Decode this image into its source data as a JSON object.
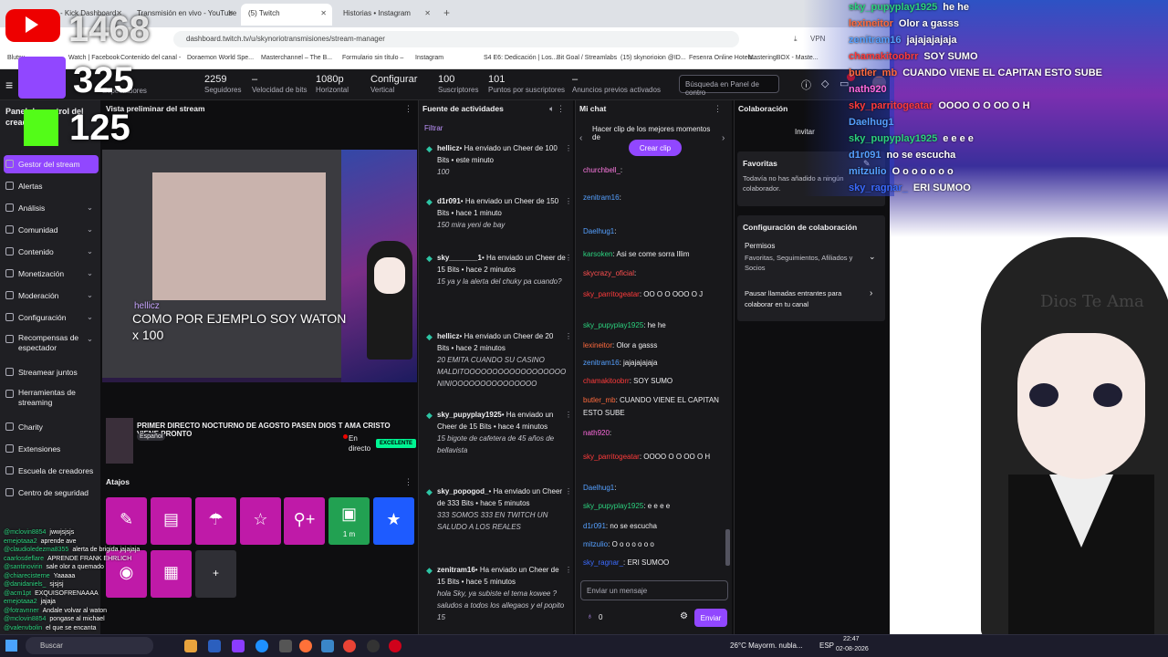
{
  "browser": {
    "tabs": [
      "Stream - Kick Dashboard",
      "Transmisión en vivo - YouTube",
      "(5) Twitch",
      "Historias • Instagram"
    ],
    "url": "dashboard.twitch.tv/u/skynoriotransmisiones/stream-manager",
    "bookmarks": [
      "Blutsu",
      "Watch | Facebook",
      "Contenido del canal -",
      "Doraemon World Spe...",
      "Masterchannel – The B...",
      "Formulario sin título –",
      "Instagram",
      "S4 E6: Dedicación | Los...",
      "Bit Goal / Streamlabs",
      "(15) skynorioion @ID...",
      "Fesenra Online Hotels...",
      "MasteringBOX - Maste..."
    ]
  },
  "topbar": {
    "stats": [
      {
        "value": "2259",
        "label": "Seguidores"
      },
      {
        "value": "–",
        "label": "Velocidad de bits"
      },
      {
        "value": "1080p",
        "label": "Horizontal"
      },
      {
        "value": "Configurar",
        "label": "Vertical"
      },
      {
        "value": "100",
        "label": "Suscriptores"
      },
      {
        "value": "101",
        "label": "Puntos por suscriptores"
      },
      {
        "value": "–",
        "label": "Anuncios previos activados"
      }
    ],
    "viewers_label": "Espectadores",
    "search_placeholder": "Búsqueda en Panel de contro",
    "notif_count": "1"
  },
  "overlay_left": {
    "counter1": "1468",
    "counter2": "325",
    "counter3": "125"
  },
  "nav": {
    "title": "Panel de control del creador",
    "items": [
      {
        "label": "Gestor del stream",
        "active": true
      },
      {
        "label": "Alertas"
      },
      {
        "label": "Análisis",
        "chev": true
      },
      {
        "label": "Comunidad",
        "chev": true
      },
      {
        "label": "Contenido",
        "chev": true
      },
      {
        "label": "Monetización",
        "chev": true
      },
      {
        "label": "Moderación",
        "chev": true
      },
      {
        "label": "Configuración",
        "chev": true
      },
      {
        "label": "Recompensas de espectador",
        "chev": true
      },
      {
        "label": "Streamear juntos"
      },
      {
        "label": "Herramientas de streaming"
      },
      {
        "label": "Charity"
      },
      {
        "label": "Extensiones"
      },
      {
        "label": "Escuela de creadores"
      },
      {
        "label": "Centro de seguridad"
      }
    ]
  },
  "preview": {
    "header": "Vista preliminar del stream",
    "overlay_text": "COMO POR EJEMPLO SOY WATON x 100",
    "user": "hellicz",
    "title": "PRIMER DIRECTO NOCTURNO DE AGOSTO PASEN DIOS T AMA CRISTO VIENE PRONTO",
    "lang": "Español",
    "live": "En directo",
    "quality": "EXCELENTE"
  },
  "actions": {
    "header": "Atajos",
    "timer": "1 m",
    "add": "+"
  },
  "feed": {
    "header": "Fuente de actividades",
    "filter": "Filtrar",
    "items": [
      {
        "user": "hellicz",
        "text": "• Ha enviado un Cheer de 100 Bits • este minuto",
        "msg": "100"
      },
      {
        "user": "d1r091",
        "text": "• Ha enviado un Cheer de 150 Bits • hace 1 minuto",
        "msg": "150 mira yeni de bay"
      },
      {
        "user": "sky_______1",
        "text": "• Ha enviado un Cheer de 15 Bits • hace 2 minutos",
        "msg": "15 ya y la alerta del chuky pa cuando?"
      },
      {
        "user": "hellicz",
        "text": "• Ha enviado un Cheer de 20 Bits • hace 2 minutos",
        "msg": "20 EMITA CUANDO SU CASINO MALDITOOOOOOOOOOOOOOOOOO NINIOOOOOOOOOOOOOOO"
      },
      {
        "user": "sky_pupyplay1925",
        "text": "• Ha enviado un Cheer de 15 Bits • hace 4 minutos",
        "msg": "15 bigote de cafetera de 45 años de bellavista"
      },
      {
        "user": "sky_popogod_",
        "text": "• Ha enviado un Cheer de 333 Bits • hace 5 minutos",
        "msg": "333 SOMOS 333 EN TWITCH UN SALUDO A LOS REALES"
      },
      {
        "user": "zenitram16",
        "text": "• Ha enviado un Cheer de 15 Bits • hace 5 minutos",
        "msg": "hola Sky, ya subiste el tema kowee ? saludos a todos los allegaos y el popito 15"
      }
    ]
  },
  "chat": {
    "header": "Mi chat",
    "clip_banner": "Hacer clip de los mejores momentos de",
    "clip_button": "Crear clip",
    "input_placeholder": "Enviar un mensaje",
    "send": "Enviar",
    "points": "0",
    "lines": [
      {
        "user": "churchbell_",
        "color": "#ff7ae3",
        "msg": ""
      },
      {
        "user": "zenitram16",
        "color": "#55a0ff",
        "msg": ""
      },
      {
        "user": "Daelhug1",
        "color": "#55a0ff",
        "msg": ""
      },
      {
        "user": "karsoken",
        "color": "#2cd37f",
        "msg": "Asi se come sorra lllim"
      },
      {
        "user": "skycrazy_oficial",
        "color": "#ff4f4f",
        "msg": ""
      },
      {
        "user": "sky_parritogeatar",
        "color": "#ff3b3b",
        "msg": "OO O O OOO O J"
      },
      {
        "user": "sky_pupyplay1925",
        "color": "#2cd37f",
        "msg": "he he"
      },
      {
        "user": "lexineitor",
        "color": "#ff6a3d",
        "msg": "Olor a gasss"
      },
      {
        "user": "zenitram16",
        "color": "#55a0ff",
        "msg": "jajajajajaja"
      },
      {
        "user": "chamakitoobrr",
        "color": "#ff3b3b",
        "msg": "SOY SUMO"
      },
      {
        "user": "butler_mb",
        "color": "#ff6a3d",
        "msg": "CUANDO VIENE EL CAPITAN ESTO SUBE"
      },
      {
        "user": "nath920",
        "color": "#ff6adf",
        "msg": ""
      },
      {
        "user": "sky_parritogeatar",
        "color": "#ff3b3b",
        "msg": "OOOO O O OO O H"
      },
      {
        "user": "Daelhug1",
        "color": "#55a0ff",
        "msg": ""
      },
      {
        "user": "sky_pupyplay1925",
        "color": "#2cd37f",
        "msg": "e e e e"
      },
      {
        "user": "d1r091",
        "color": "#55a0ff",
        "msg": "no se escucha"
      },
      {
        "user": "mitzulio",
        "color": "#55a0ff",
        "msg": "O o o o o o o"
      },
      {
        "user": "sky_ragnar_",
        "color": "#3b6bff",
        "msg": "ERI SUMOO"
      }
    ]
  },
  "collab": {
    "header": "Colaboración",
    "invite": "Invitar",
    "fav_title": "Favoritas",
    "fav_text": "Todavía no has añadido a ningún colaborador.",
    "config_title": "Configuración de colaboración",
    "perm_title": "Permisos",
    "perm_text": "Favoritas, Seguimientos, Afiliados y Socios",
    "pause_text": "Pausar llamadas entrantes para colaborar en tu canal"
  },
  "overlay_chat": [
    {
      "user": "sky_pupyplay1925",
      "color": "#2cd37f",
      "msg": "he he"
    },
    {
      "user": "lexineitor",
      "color": "#ff6a3d",
      "msg": "Olor a gasss"
    },
    {
      "user": "zenitram16",
      "color": "#55a0ff",
      "msg": "jajajajajaja"
    },
    {
      "user": "chamakitoobrr",
      "color": "#ff3b3b",
      "msg": "SOY SUMO"
    },
    {
      "user": "butler_mb",
      "color": "#ff6a3d",
      "msg": "CUANDO VIENE EL CAPITAN ESTO SUBE"
    },
    {
      "user": "nath920",
      "color": "#ff6adf",
      "msg": ""
    },
    {
      "user": "sky_parritogeatar",
      "color": "#ff3b3b",
      "msg": "OOOO O O OO O H"
    },
    {
      "user": "Daelhug1",
      "color": "#55a0ff",
      "msg": ""
    },
    {
      "user": "sky_pupyplay1925",
      "color": "#2cd37f",
      "msg": "e e e e"
    },
    {
      "user": "d1r091",
      "color": "#55a0ff",
      "msg": "no se escucha"
    },
    {
      "user": "mitzulio",
      "color": "#55a0ff",
      "msg": "O o o o o o o"
    },
    {
      "user": "sky_ragnar_",
      "color": "#3b6bff",
      "msg": "ERI SUMOO"
    }
  ],
  "avatar_logo": "Dios Te Ama",
  "small_chat": [
    {
      "user": "@mclovin8854",
      "msg": "jwwjsjsjs"
    },
    {
      "user": "emejotaaa2",
      "msg": "aprende ave"
    },
    {
      "user": "@claudioledezma8355",
      "msg": "alerta de brigida jajajaja"
    },
    {
      "user": "caarlosdeflare",
      "msg": "APRENDE FRANK EHRLICH"
    },
    {
      "user": "@santinovirin",
      "msg": "sale olor a quemado"
    },
    {
      "user": "@chiarecisterne",
      "msg": "Yaaaaa"
    },
    {
      "user": "@danidaniels_",
      "msg": "sjsjsj"
    },
    {
      "user": "@acm1pt",
      "msg": "EXQUISOFRENAAAA"
    },
    {
      "user": "emejotaaa2",
      "msg": "jajaja"
    },
    {
      "user": "@fotravnner",
      "msg": "Andale volvar al waton"
    },
    {
      "user": "@mclovin8854",
      "msg": "pongase al michael"
    },
    {
      "user": "@valenvbolin",
      "msg": "el que se encanta"
    }
  ],
  "taskbar": {
    "search": "Buscar",
    "weather": "26°C  Mayorm. nubla...",
    "lang": "ESP",
    "time": "22:47",
    "date": "02-08-2026"
  }
}
